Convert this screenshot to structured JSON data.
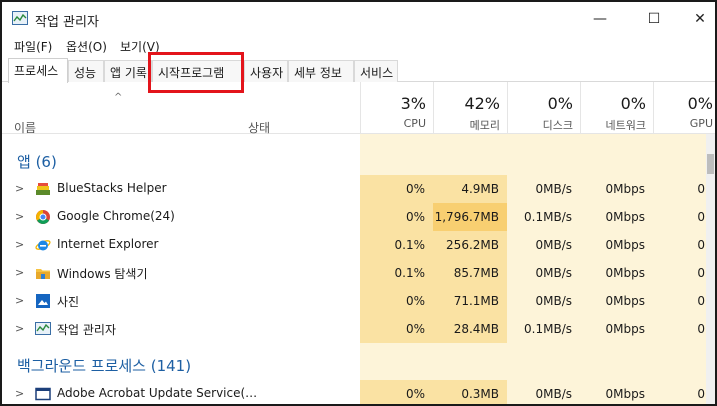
{
  "window": {
    "title": "작업 관리자",
    "min_glyph": "—",
    "max_glyph": "☐",
    "close_glyph": "✕"
  },
  "menu": [
    "파일(F)",
    "옵션(O)",
    "보기(V)"
  ],
  "tabs": [
    {
      "label": "프로세스",
      "active": true
    },
    {
      "label": "성능"
    },
    {
      "label": "앱 기록"
    },
    {
      "label": "시작프로그램",
      "highlighted": true
    },
    {
      "label": "사용자"
    },
    {
      "label": "세부 정보"
    },
    {
      "label": "서비스"
    }
  ],
  "header": {
    "name": "이름",
    "status": "상태",
    "cpu": {
      "pct": "3%",
      "label": "CPU"
    },
    "memory": {
      "pct": "42%",
      "label": "메모리"
    },
    "disk": {
      "pct": "0%",
      "label": "디스크"
    },
    "network": {
      "pct": "0%",
      "label": "네트워크"
    },
    "gpu": {
      "pct": "0%",
      "label": "GPU"
    }
  },
  "groups": {
    "apps": "앱 (6)",
    "background": "백그라운드 프로세스 (141)"
  },
  "apps": [
    {
      "name": "BlueStacks Helper",
      "icon": "bluestacks-icon",
      "cpu": "0%",
      "memory": "4.9MB",
      "disk": "0MB/s",
      "network": "0Mbps",
      "gpu": "0"
    },
    {
      "name": "Google Chrome(24)",
      "icon": "chrome-icon",
      "cpu": "0%",
      "memory": "1,796.7MB",
      "disk": "0.1MB/s",
      "network": "0Mbps",
      "gpu": "0"
    },
    {
      "name": "Internet Explorer",
      "icon": "internet-explorer-icon",
      "cpu": "0.1%",
      "memory": "256.2MB",
      "disk": "0MB/s",
      "network": "0Mbps",
      "gpu": "0"
    },
    {
      "name": "Windows 탐색기",
      "icon": "file-explorer-icon",
      "cpu": "0.1%",
      "memory": "85.7MB",
      "disk": "0MB/s",
      "network": "0Mbps",
      "gpu": "0"
    },
    {
      "name": "사진",
      "icon": "photos-icon",
      "cpu": "0%",
      "memory": "71.1MB",
      "disk": "0MB/s",
      "network": "0Mbps",
      "gpu": "0"
    },
    {
      "name": "작업 관리자",
      "icon": "task-manager-icon",
      "cpu": "0%",
      "memory": "28.4MB",
      "disk": "0.1MB/s",
      "network": "0Mbps",
      "gpu": "0"
    }
  ],
  "background": [
    {
      "name": "Adobe Acrobat Update Service(…",
      "icon": "service-window-icon",
      "cpu": "0%",
      "memory": "0.3MB",
      "disk": "0MB/s",
      "network": "0Mbps",
      "gpu": "0"
    }
  ],
  "colors": {
    "group_label": "#1d5fa3",
    "heat_light": "#fdf4d9",
    "heat_mid": "#fae2a3",
    "heat_hot": "#f8cf71",
    "highlight": "#e3141b"
  }
}
